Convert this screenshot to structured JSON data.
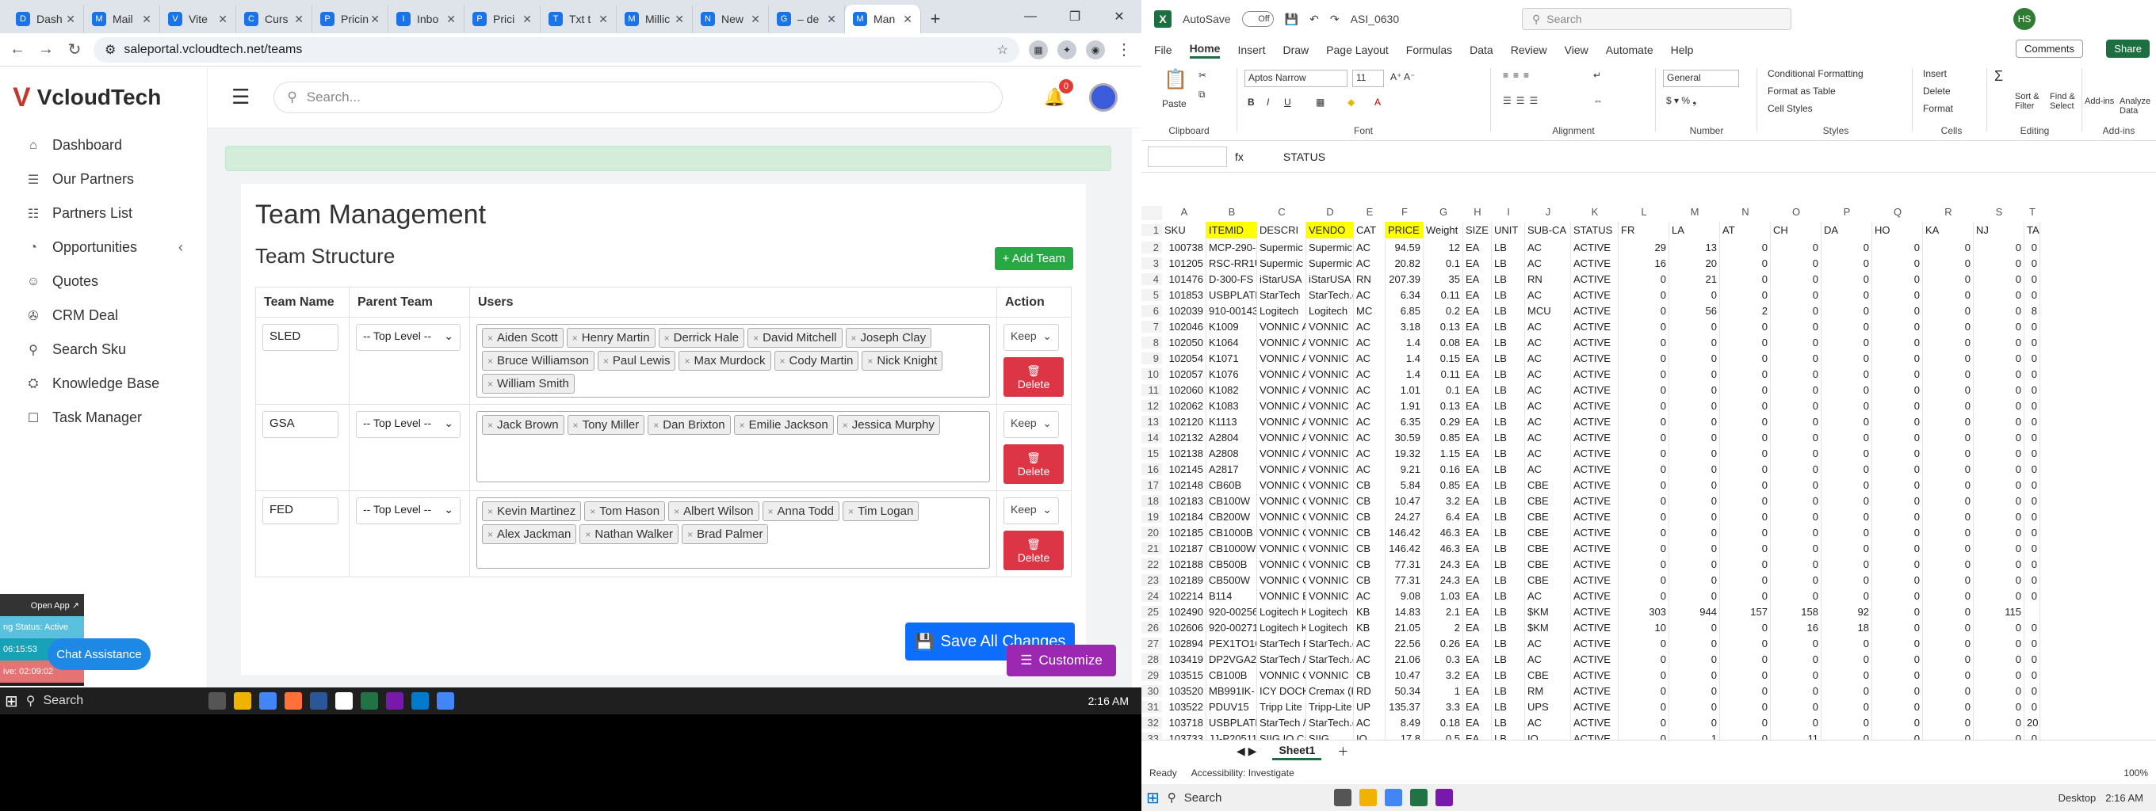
{
  "browser": {
    "tabs": [
      {
        "label": "Dash",
        "fav": "D"
      },
      {
        "label": "Mail",
        "fav": "M"
      },
      {
        "label": "Vite",
        "fav": "V"
      },
      {
        "label": "Curs",
        "fav": "C"
      },
      {
        "label": "Pricin",
        "fav": "P"
      },
      {
        "label": "Inbo",
        "fav": "I"
      },
      {
        "label": "Prici",
        "fav": "P"
      },
      {
        "label": "Txt t",
        "fav": "T"
      },
      {
        "label": "Millic",
        "fav": "M"
      },
      {
        "label": "New",
        "fav": "N"
      },
      {
        "label": "– de",
        "fav": "G"
      },
      {
        "label": "Man",
        "fav": "M"
      }
    ],
    "url": "saleportal.vcloudtech.net/teams"
  },
  "app": {
    "logo": "VcloudTech",
    "search_placeholder": "Search...",
    "notification_count": "0",
    "sidebar": [
      {
        "label": "Dashboard",
        "icon": "⌂"
      },
      {
        "label": "Our Partners",
        "icon": "☰"
      },
      {
        "label": "Partners List",
        "icon": "☷"
      },
      {
        "label": "Opportunities",
        "icon": "◔"
      },
      {
        "label": "Quotes",
        "icon": "☺"
      },
      {
        "label": "CRM Deal",
        "icon": "✇"
      },
      {
        "label": "Search Sku",
        "icon": "⚲"
      },
      {
        "label": "Knowledge Base",
        "icon": "⛭"
      },
      {
        "label": "Task Manager",
        "icon": "☐"
      }
    ]
  },
  "page": {
    "title": "Team Management",
    "subtitle": "Team Structure",
    "add_team": "+ Add Team",
    "headers": {
      "team": "Team Name",
      "parent": "Parent Team",
      "users": "Users",
      "action": "Action"
    },
    "teams": [
      {
        "name": "SLED",
        "parent": "-- Top Level --",
        "keep": "Keep",
        "delete": "Delete",
        "users": [
          "Aiden Scott",
          "Henry Martin",
          "Derrick Hale",
          "David Mitchell",
          "Joseph Clay",
          "Bruce Williamson",
          "Paul Lewis",
          "Max Murdock",
          "Cody Martin",
          "Nick Knight",
          "William Smith"
        ]
      },
      {
        "name": "GSA",
        "parent": "-- Top Level --",
        "keep": "Keep",
        "delete": "Delete",
        "users": [
          "Jack Brown",
          "Tony Miller",
          "Dan Brixton",
          "Emilie Jackson",
          "Jessica Murphy"
        ]
      },
      {
        "name": "FED",
        "parent": "-- Top Level --",
        "keep": "Keep",
        "delete": "Delete",
        "users": [
          "Kevin Martinez",
          "Tom Hason",
          "Albert Wilson",
          "Anna Todd",
          "Tim Logan",
          "Alex Jackman",
          "Nathan Walker",
          "Brad Palmer"
        ]
      }
    ],
    "save_all": "Save All Changes",
    "customize": "Customize",
    "chat": "Chat Assistance"
  },
  "widget": {
    "open_app": "Open App ↗",
    "status": "ng Status: Active",
    "time1": "06:15:53",
    "time2": "ive: 02:09:02"
  },
  "taskbar_left": {
    "search": "Search",
    "clock": "2:16 AM"
  },
  "excel": {
    "autosave": "AutoSave",
    "autosave_state": "Off",
    "filename": "ASI_0630",
    "search": "Search",
    "user_initials": "HS",
    "menu": [
      "File",
      "Home",
      "Insert",
      "Draw",
      "Page Layout",
      "Formulas",
      "Data",
      "Review",
      "View",
      "Automate",
      "Help"
    ],
    "comments": "Comments",
    "share": "Share",
    "ribbon": {
      "clipboard": "Clipboard",
      "paste": "Paste",
      "font": "Font",
      "font_name": "Aptos Narrow",
      "font_size": "11",
      "alignment": "Alignment",
      "number": "Number",
      "number_format": "General",
      "styles": "Styles",
      "cond_format": "Conditional Formatting",
      "format_table": "Format as Table",
      "cell_styles": "Cell Styles",
      "cells": "Cells",
      "insert": "Insert",
      "delete": "Delete",
      "format": "Format",
      "editing": "Editing",
      "sort": "Sort & Filter",
      "find": "Find & Select",
      "addins": "Add-ins",
      "analyze": "Analyze Data",
      "addins_group": "Add-ins"
    },
    "formula_label": "fx",
    "formula": "STATUS",
    "columns": [
      "A",
      "B",
      "C",
      "D",
      "E",
      "F",
      "G",
      "H",
      "I",
      "J",
      "K",
      "L",
      "M",
      "N",
      "O",
      "P",
      "Q",
      "R",
      "S",
      "T"
    ],
    "header_row": [
      "SKU",
      "ITEMID",
      "DESCRI",
      "VENDO",
      "CAT",
      "PRICE",
      "Weight",
      "SIZE",
      "UNIT",
      "SUB-CA",
      "STATUS",
      "FR",
      "LA",
      "AT",
      "CH",
      "DA",
      "HO",
      "KA",
      "NJ",
      "TA"
    ],
    "rows": [
      [
        "100738",
        "MCP-290-",
        "Supermic",
        "Supermic",
        "AC",
        "94.59",
        "12",
        "EA",
        "LB",
        "AC",
        "ACTIVE",
        "29",
        "13",
        "0",
        "0",
        "0",
        "0",
        "0",
        "0",
        "0"
      ],
      [
        "101205",
        "RSC-RR1U",
        "Supermic",
        "Supermic",
        "AC",
        "20.82",
        "0.1",
        "EA",
        "LB",
        "AC",
        "ACTIVE",
        "16",
        "20",
        "0",
        "0",
        "0",
        "0",
        "0",
        "0",
        "0"
      ],
      [
        "101476",
        "D-300-FS",
        "iStarUSA",
        "iStarUSA",
        "RN",
        "207.39",
        "35",
        "EA",
        "LB",
        "RN",
        "ACTIVE",
        "0",
        "21",
        "0",
        "0",
        "0",
        "0",
        "0",
        "0",
        "0"
      ],
      [
        "101853",
        "USBPLATE",
        "StarTech",
        "StarTech.c",
        "AC",
        "6.34",
        "0.11",
        "EA",
        "LB",
        "AC",
        "ACTIVE",
        "0",
        "0",
        "0",
        "0",
        "0",
        "0",
        "0",
        "0",
        "0"
      ],
      [
        "102039",
        "910-00143",
        "Logitech",
        "Logitech",
        "MC",
        "6.85",
        "0.2",
        "EA",
        "LB",
        "MCU",
        "ACTIVE",
        "0",
        "56",
        "2",
        "0",
        "0",
        "0",
        "0",
        "0",
        "8"
      ],
      [
        "102046",
        "K1009",
        "VONNIC A",
        "VONNIC",
        "AC",
        "3.18",
        "0.13",
        "EA",
        "LB",
        "AC",
        "ACTIVE",
        "0",
        "0",
        "0",
        "0",
        "0",
        "0",
        "0",
        "0",
        "0"
      ],
      [
        "102050",
        "K1064",
        "VONNIC A",
        "VONNIC",
        "AC",
        "1.4",
        "0.08",
        "EA",
        "LB",
        "AC",
        "ACTIVE",
        "0",
        "0",
        "0",
        "0",
        "0",
        "0",
        "0",
        "0",
        "0"
      ],
      [
        "102054",
        "K1071",
        "VONNIC A",
        "VONNIC",
        "AC",
        "1.4",
        "0.15",
        "EA",
        "LB",
        "AC",
        "ACTIVE",
        "0",
        "0",
        "0",
        "0",
        "0",
        "0",
        "0",
        "0",
        "0"
      ],
      [
        "102057",
        "K1076",
        "VONNIC A",
        "VONNIC",
        "AC",
        "1.4",
        "0.11",
        "EA",
        "LB",
        "AC",
        "ACTIVE",
        "0",
        "0",
        "0",
        "0",
        "0",
        "0",
        "0",
        "0",
        "0"
      ],
      [
        "102060",
        "K1082",
        "VONNIC A",
        "VONNIC",
        "AC",
        "1.01",
        "0.1",
        "EA",
        "LB",
        "AC",
        "ACTIVE",
        "0",
        "0",
        "0",
        "0",
        "0",
        "0",
        "0",
        "0",
        "0"
      ],
      [
        "102062",
        "K1083",
        "VONNIC A",
        "VONNIC",
        "AC",
        "1.91",
        "0.13",
        "EA",
        "LB",
        "AC",
        "ACTIVE",
        "0",
        "0",
        "0",
        "0",
        "0",
        "0",
        "0",
        "0",
        "0"
      ],
      [
        "102120",
        "K1113",
        "VONNIC A",
        "VONNIC",
        "AC",
        "6.35",
        "0.29",
        "EA",
        "LB",
        "AC",
        "ACTIVE",
        "0",
        "0",
        "0",
        "0",
        "0",
        "0",
        "0",
        "0",
        "0"
      ],
      [
        "102132",
        "A2804",
        "VONNIC A",
        "VONNIC",
        "AC",
        "30.59",
        "0.85",
        "EA",
        "LB",
        "AC",
        "ACTIVE",
        "0",
        "0",
        "0",
        "0",
        "0",
        "0",
        "0",
        "0",
        "0"
      ],
      [
        "102138",
        "A2808",
        "VONNIC A",
        "VONNIC",
        "AC",
        "19.32",
        "1.15",
        "EA",
        "LB",
        "AC",
        "ACTIVE",
        "0",
        "0",
        "0",
        "0",
        "0",
        "0",
        "0",
        "0",
        "0"
      ],
      [
        "102145",
        "A2817",
        "VONNIC A",
        "VONNIC",
        "AC",
        "9.21",
        "0.16",
        "EA",
        "LB",
        "AC",
        "ACTIVE",
        "0",
        "0",
        "0",
        "0",
        "0",
        "0",
        "0",
        "0",
        "0"
      ],
      [
        "102148",
        "CB60B",
        "VONNIC C",
        "VONNIC",
        "CB",
        "5.84",
        "0.85",
        "EA",
        "LB",
        "CBE",
        "ACTIVE",
        "0",
        "0",
        "0",
        "0",
        "0",
        "0",
        "0",
        "0",
        "0"
      ],
      [
        "102183",
        "CB100W",
        "VONNIC C",
        "VONNIC",
        "CB",
        "10.47",
        "3.2",
        "EA",
        "LB",
        "CBE",
        "ACTIVE",
        "0",
        "0",
        "0",
        "0",
        "0",
        "0",
        "0",
        "0",
        "0"
      ],
      [
        "102184",
        "CB200W",
        "VONNIC C",
        "VONNIC",
        "CB",
        "24.27",
        "6.4",
        "EA",
        "LB",
        "CBE",
        "ACTIVE",
        "0",
        "0",
        "0",
        "0",
        "0",
        "0",
        "0",
        "0",
        "0"
      ],
      [
        "102185",
        "CB1000B",
        "VONNIC C",
        "VONNIC",
        "CB",
        "146.42",
        "46.3",
        "EA",
        "LB",
        "CBE",
        "ACTIVE",
        "0",
        "0",
        "0",
        "0",
        "0",
        "0",
        "0",
        "0",
        "0"
      ],
      [
        "102187",
        "CB1000W",
        "VONNIC C",
        "VONNIC",
        "CB",
        "146.42",
        "46.3",
        "EA",
        "LB",
        "CBE",
        "ACTIVE",
        "0",
        "0",
        "0",
        "0",
        "0",
        "0",
        "0",
        "0",
        "0"
      ],
      [
        "102188",
        "CB500B",
        "VONNIC C",
        "VONNIC",
        "CB",
        "77.31",
        "24.3",
        "EA",
        "LB",
        "CBE",
        "ACTIVE",
        "0",
        "0",
        "0",
        "0",
        "0",
        "0",
        "0",
        "0",
        "0"
      ],
      [
        "102189",
        "CB500W",
        "VONNIC C",
        "VONNIC",
        "CB",
        "77.31",
        "24.3",
        "EA",
        "LB",
        "CBE",
        "ACTIVE",
        "0",
        "0",
        "0",
        "0",
        "0",
        "0",
        "0",
        "0",
        "0"
      ],
      [
        "102214",
        "B114",
        "VONNIC B",
        "VONNIC",
        "AC",
        "9.08",
        "1.03",
        "EA",
        "LB",
        "AC",
        "ACTIVE",
        "0",
        "0",
        "0",
        "0",
        "0",
        "0",
        "0",
        "0",
        "0"
      ],
      [
        "102490",
        "920-00256",
        "Logitech K",
        "Logitech",
        "KB",
        "14.83",
        "2.1",
        "EA",
        "LB",
        "$KM",
        "ACTIVE",
        "303",
        "944",
        "157",
        "158",
        "92",
        "0",
        "0",
        "115",
        ""
      ],
      [
        "102606",
        "920-00271",
        "Logitech K",
        "Logitech",
        "KB",
        "21.05",
        "2",
        "EA",
        "LB",
        "$KM",
        "ACTIVE",
        "10",
        "0",
        "0",
        "16",
        "18",
        "0",
        "0",
        "0",
        "0"
      ],
      [
        "102894",
        "PEX1TO16",
        "StarTech F",
        "StarTech.c",
        "AC",
        "22.56",
        "0.26",
        "EA",
        "LB",
        "AC",
        "ACTIVE",
        "0",
        "0",
        "0",
        "0",
        "0",
        "0",
        "0",
        "0",
        "0"
      ],
      [
        "103419",
        "DP2VGA2",
        "StarTech /",
        "StarTech.c",
        "AC",
        "21.06",
        "0.3",
        "EA",
        "LB",
        "AC",
        "ACTIVE",
        "0",
        "0",
        "0",
        "0",
        "0",
        "0",
        "0",
        "0",
        "0"
      ],
      [
        "103515",
        "CB100B",
        "VONNIC C",
        "VONNIC",
        "CB",
        "10.47",
        "3.2",
        "EA",
        "LB",
        "CBE",
        "ACTIVE",
        "0",
        "0",
        "0",
        "0",
        "0",
        "0",
        "0",
        "0",
        "0"
      ],
      [
        "103520",
        "MB991IK-",
        "ICY DOCK",
        "Cremax (H",
        "RD",
        "50.34",
        "1",
        "EA",
        "LB",
        "RM",
        "ACTIVE",
        "0",
        "0",
        "0",
        "0",
        "0",
        "0",
        "0",
        "0",
        "0"
      ],
      [
        "103522",
        "PDUV15",
        "Tripp Lite",
        "Tripp-Lite",
        "UP",
        "135.37",
        "3.3",
        "EA",
        "LB",
        "UPS",
        "ACTIVE",
        "0",
        "0",
        "0",
        "0",
        "0",
        "0",
        "0",
        "0",
        "0"
      ],
      [
        "103718",
        "USBPLATE",
        "StarTech /",
        "StarTech.c",
        "AC",
        "8.49",
        "0.18",
        "EA",
        "LB",
        "AC",
        "ACTIVE",
        "0",
        "0",
        "0",
        "0",
        "0",
        "0",
        "0",
        "0",
        "20"
      ],
      [
        "103733",
        "JJ-P20511",
        "SIIG IO Ca",
        "SIIG",
        "IO",
        "17.8",
        "0.5",
        "EA",
        "LB",
        "IO",
        "ACTIVE",
        "0",
        "1",
        "0",
        "11",
        "0",
        "0",
        "0",
        "0",
        "0"
      ]
    ],
    "sheet": "Sheet1",
    "status_ready": "Ready",
    "accessibility": "Accessibility: Investigate",
    "zoom": "100%"
  },
  "taskbar_right": {
    "search": "Search",
    "desktop": "Desktop",
    "clock": "2:16 AM"
  }
}
